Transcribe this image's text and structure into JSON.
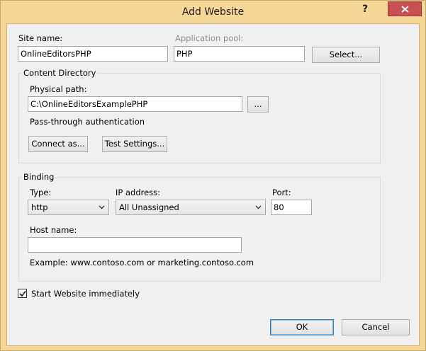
{
  "window": {
    "title": "Add Website",
    "help": "?"
  },
  "site": {
    "name_label": "Site name:",
    "name_value": "OnlineEditorsPHP",
    "pool_label": "Application pool:",
    "pool_value": "PHP",
    "select_button": "Select..."
  },
  "content": {
    "group_title": "Content Directory",
    "path_label": "Physical path:",
    "path_value": "C:\\OnlineEditorsExamplePHP",
    "browse_button": "...",
    "auth_text": "Pass-through authentication",
    "connect_button": "Connect as...",
    "test_button": "Test Settings..."
  },
  "binding": {
    "group_title": "Binding",
    "type_label": "Type:",
    "type_value": "http",
    "ip_label": "IP address:",
    "ip_value": "All Unassigned",
    "port_label": "Port:",
    "port_value": "80",
    "host_label": "Host name:",
    "host_value": "",
    "example_text": "Example: www.contoso.com or marketing.contoso.com"
  },
  "start": {
    "label": "Start Website immediately",
    "checked": true
  },
  "footer": {
    "ok_button": "OK",
    "cancel_button": "Cancel"
  }
}
